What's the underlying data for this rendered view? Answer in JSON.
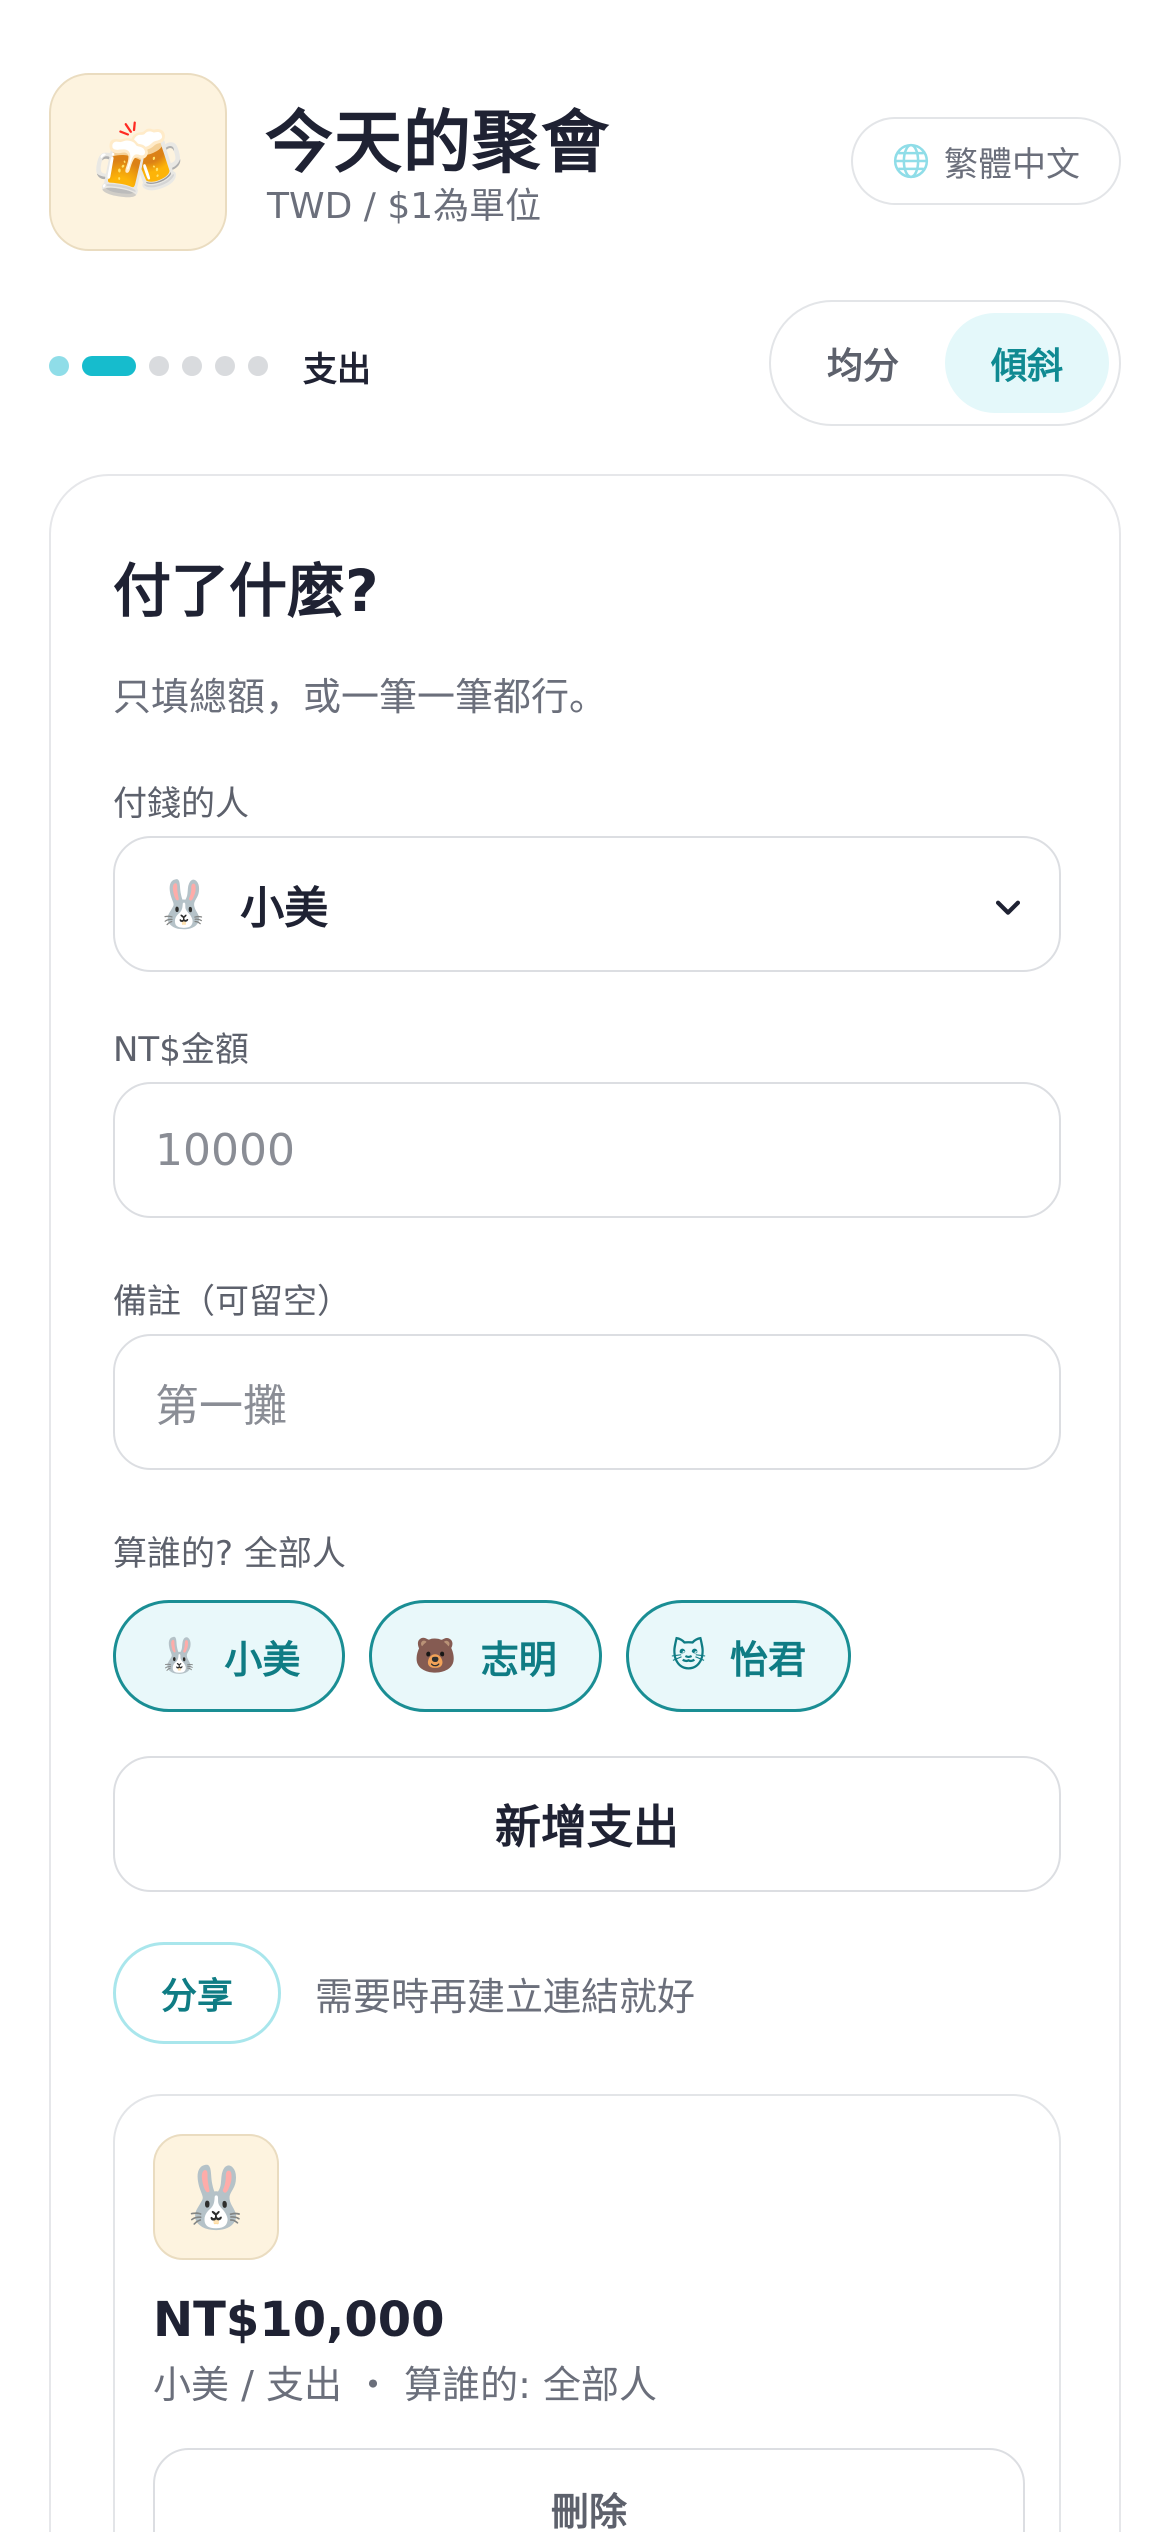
{
  "header": {
    "app_icon": "beer-mugs-icon",
    "app_icon_glyph": "🍻",
    "title": "今天的聚會",
    "subtitle": "TWD / $1為單位",
    "language_label": "繁體中文",
    "language_icon": "globe-icon"
  },
  "progress": {
    "total_steps": 6,
    "current_step": 2,
    "step_label": "支出"
  },
  "split_mode": {
    "options": [
      "均分",
      "傾斜"
    ],
    "selected": "傾斜"
  },
  "form": {
    "heading": "付了什麼?",
    "hint": "只填總額，或一筆一筆都行。",
    "payer": {
      "label": "付錢的人",
      "emoji": "🐰",
      "value": "小美"
    },
    "amount": {
      "label": "NT$金額",
      "placeholder": "10000"
    },
    "note": {
      "label": "備註（可留空）",
      "placeholder": "第一攤"
    },
    "for_whom": {
      "label": "算誰的? 全部人",
      "people": [
        {
          "emoji": "🐰",
          "name": "小美"
        },
        {
          "emoji": "🐻",
          "name": "志明"
        },
        {
          "emoji": "🐱",
          "name": "怡君"
        }
      ]
    },
    "add_button": "新增支出"
  },
  "share": {
    "button": "分享",
    "hint": "需要時再建立連結就好"
  },
  "expense_item": {
    "avatar": "🐰",
    "amount": "NT$10,000",
    "meta": "小美 / 支出 ・ 算誰的: 全部人",
    "delete_button": "刪除"
  },
  "colors": {
    "accent": "#16bccd",
    "accent_text": "#0f8a92",
    "chip_border": "#1a8e94",
    "icon_bg": "#fdf3df"
  }
}
